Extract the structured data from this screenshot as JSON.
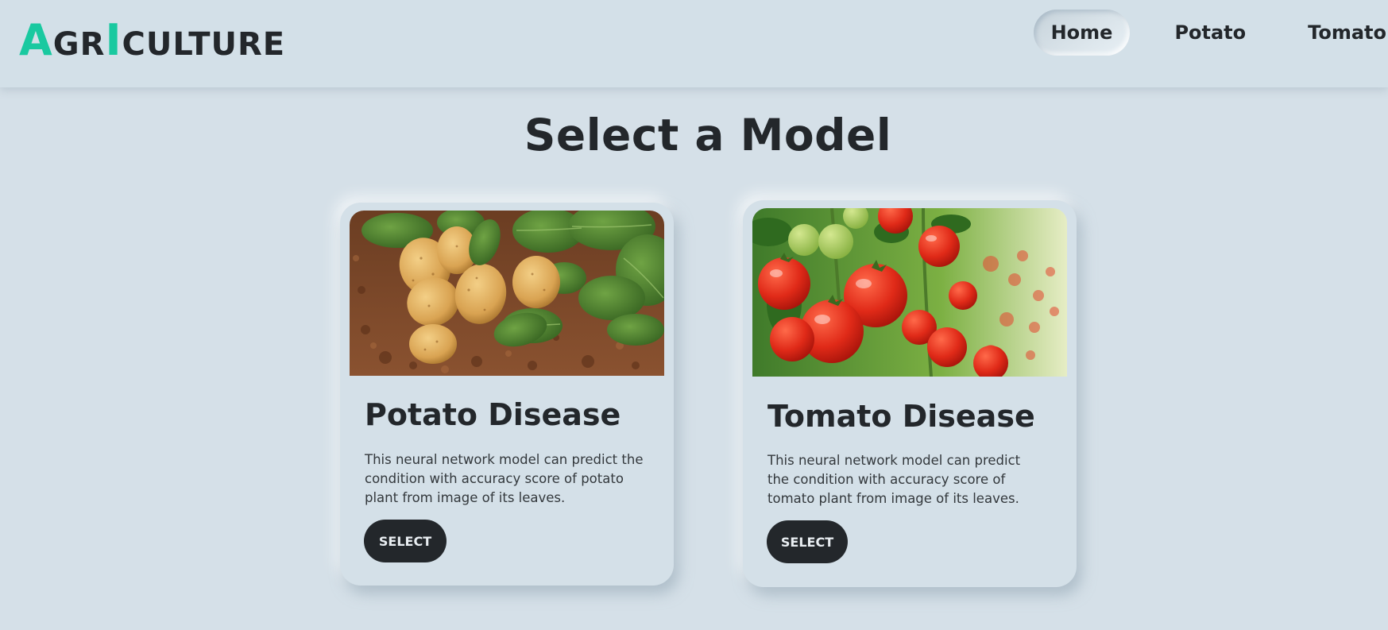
{
  "logo": {
    "first_letter": "A",
    "part_one": "GR",
    "middle_letter": "I",
    "part_two": "CULTURE"
  },
  "nav": {
    "items": [
      {
        "label": "Home",
        "active": true
      },
      {
        "label": "Potato",
        "active": false
      },
      {
        "label": "Tomato",
        "active": false
      }
    ]
  },
  "main": {
    "title": "Select a Model",
    "cards": [
      {
        "title": "Potato Disease",
        "description": "This neural network model can predict the condition with accuracy score of potato plant from image of its leaves.",
        "button_label": "SELECT"
      },
      {
        "title": "Tomato Disease",
        "description": "This neural network model can predict the condition with accuracy score of tomato plant from image of its leaves.",
        "button_label": "SELECT"
      }
    ]
  },
  "colors": {
    "background": "#d5e0e8",
    "logo_accent": "#19c9a0",
    "text_dark": "#23272b",
    "button_bg": "#23272b"
  }
}
